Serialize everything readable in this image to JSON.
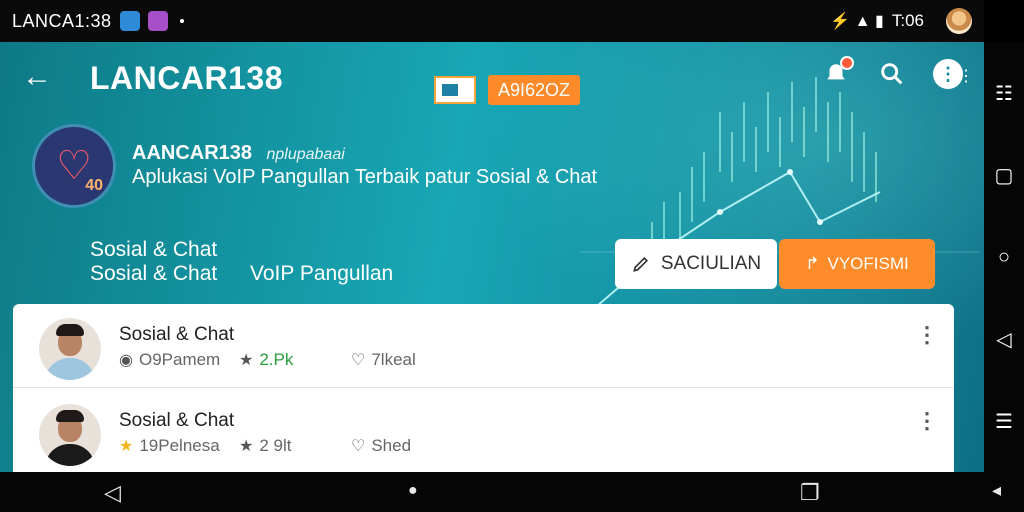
{
  "status_bar": {
    "time": "LANCA1:38",
    "right_time": "T:06",
    "signal_glyphs": "⚡ ▲ ▮"
  },
  "header": {
    "title": "LANCAR138",
    "badge": "A9I62OZ",
    "icons": [
      "back-arrow-icon",
      "flag-icon",
      "bell-icon",
      "search-icon",
      "more-icon"
    ]
  },
  "hero": {
    "logo_number": "40",
    "brand_name": "AANCAR138",
    "brand_sub": "nplupabaai",
    "tagline": "Aplukasi VoIP Pangullan Terbaik patur Sosial & Chat",
    "category_1": "Sosial & Chat",
    "category_2": "Sosial & Chat",
    "category_3": "VoIP Pangullan",
    "save_button": "SACIULIAN",
    "primary_button": "VYOFISMI"
  },
  "list": [
    {
      "title": "Sosial & Chat",
      "meta_1": "O9Pamem",
      "meta_2": "2.Pk",
      "meta_3": "7lkeal"
    },
    {
      "title": "Sosial & Chat",
      "meta_1": "19Pelnesa",
      "meta_2": "2 9lt",
      "meta_3": "Shed"
    }
  ],
  "colors": {
    "hero_start": "#0e7a86",
    "hero_mid": "#18a7b5",
    "accent_orange": "#ff8c2a",
    "green": "#2a9d3a"
  }
}
